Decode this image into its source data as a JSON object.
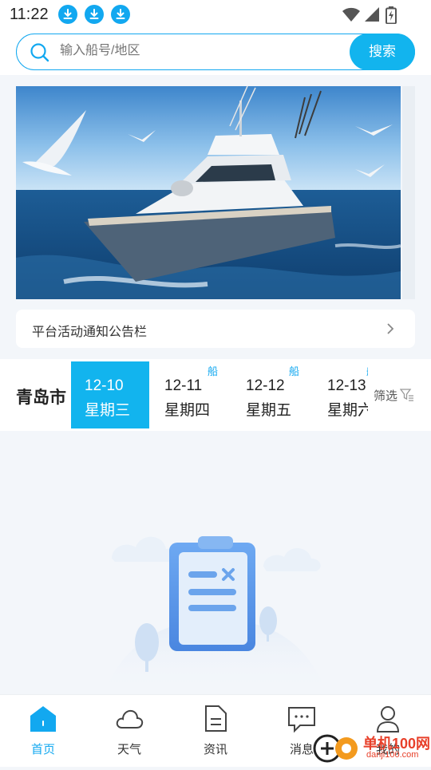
{
  "status_bar": {
    "time": "11:22",
    "download_icons": [
      "download-icon",
      "download-icon",
      "download-icon"
    ],
    "system_icons": [
      "wifi-icon",
      "signal-icon",
      "battery-charging-icon"
    ]
  },
  "search": {
    "placeholder": "输入船号/地区",
    "button_label": "搜索"
  },
  "banner": {
    "image": "yacht-with-seagulls",
    "page_count": 3,
    "active_index": 1
  },
  "notice": {
    "label": "平台活动通知公告栏"
  },
  "date_bar": {
    "city": "青岛市",
    "dates": [
      {
        "day": "12-10",
        "week": "星期三",
        "tag": "",
        "active": true
      },
      {
        "day": "12-11",
        "week": "星期四",
        "tag": "船",
        "active": false
      },
      {
        "day": "12-12",
        "week": "星期五",
        "tag": "船",
        "active": false
      },
      {
        "day": "12-13",
        "week": "星期六",
        "tag": "船",
        "active": false
      }
    ],
    "filter_label": "筛选"
  },
  "empty_state": {
    "illustration": "clipboard-empty-icon"
  },
  "tab_bar": {
    "tabs": [
      {
        "label": "首页",
        "icon": "home-icon",
        "active": true
      },
      {
        "label": "天气",
        "icon": "cloud-icon",
        "active": false
      },
      {
        "label": "资讯",
        "icon": "document-icon",
        "active": false
      },
      {
        "label": "消息",
        "icon": "message-icon",
        "active": false
      },
      {
        "label": "我的",
        "icon": "user-icon",
        "active": false
      }
    ]
  },
  "watermark": {
    "title": "单机100网",
    "subtitle": "danji100.com"
  },
  "colors": {
    "accent": "#12b4ee",
    "background": "#f3f6fa",
    "watermark": "#e8402a"
  }
}
